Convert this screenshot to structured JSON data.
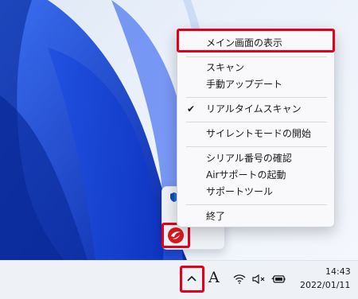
{
  "context_menu": {
    "items": [
      {
        "label": "メイン画面の表示"
      },
      {
        "label": "スキャン"
      },
      {
        "label": "手動アップデート"
      },
      {
        "label": "リアルタイムスキャン",
        "checked": true
      },
      {
        "label": "サイレントモードの開始"
      },
      {
        "label": "シリアル番号の確認"
      },
      {
        "label": "Airサポートの起動"
      },
      {
        "label": "サポートツール"
      },
      {
        "label": "終了"
      }
    ],
    "check_glyph": "✔"
  },
  "taskbar": {
    "input_indicator": "A",
    "time": "14:43",
    "date": "2022/01/11",
    "chevron_glyph": "^",
    "volume_glyph": "🔇",
    "battery_glyph": "🔋"
  },
  "icons": [
    "windows-security-icon",
    "trend-micro-icon",
    "wifi-icon",
    "volume-muted-icon",
    "battery-icon",
    "chevron-up-icon"
  ],
  "colors": {
    "highlight": "#e4001b",
    "wallpaper_blue": "#1746d6",
    "trend_red": "#d71920"
  }
}
